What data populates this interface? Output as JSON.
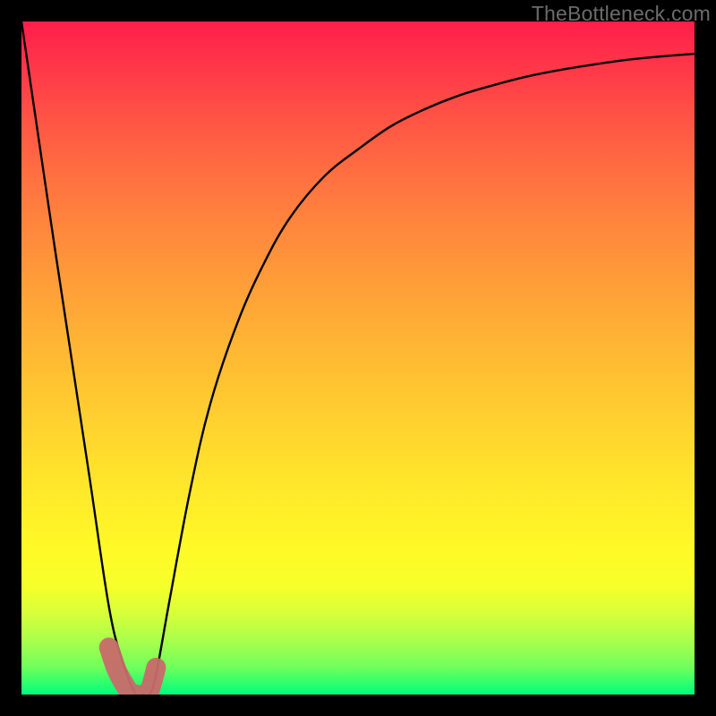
{
  "watermark": {
    "text": "TheBottleneck.com"
  },
  "colors": {
    "background": "#000000",
    "curve_primary": "#000000",
    "curve_secondary": "#b85c5c",
    "gradient_top": "#ff1e4a",
    "gradient_bottom": "#00ff80"
  },
  "chart_data": {
    "type": "line",
    "title": "",
    "xlabel": "",
    "ylabel": "",
    "xlim": [
      0,
      100
    ],
    "ylim": [
      0,
      100
    ],
    "series": [
      {
        "name": "bottleneck-curve",
        "x": [
          0,
          5,
          10,
          13,
          15,
          17,
          18,
          19,
          20,
          22,
          25,
          28,
          32,
          36,
          40,
          45,
          50,
          55,
          60,
          65,
          70,
          75,
          80,
          85,
          90,
          95,
          100
        ],
        "values": [
          100,
          66,
          33,
          13,
          5,
          0,
          0,
          0,
          3,
          14,
          30,
          43,
          55,
          64,
          71,
          77,
          81,
          84.5,
          87,
          89,
          90.5,
          91.8,
          92.8,
          93.6,
          94.3,
          94.8,
          95.2
        ]
      },
      {
        "name": "highlight-segment",
        "x": [
          13,
          14,
          15,
          16,
          17,
          18,
          19,
          20
        ],
        "values": [
          7,
          4,
          2,
          0.5,
          0,
          0,
          0.5,
          4
        ]
      }
    ],
    "annotations": []
  }
}
